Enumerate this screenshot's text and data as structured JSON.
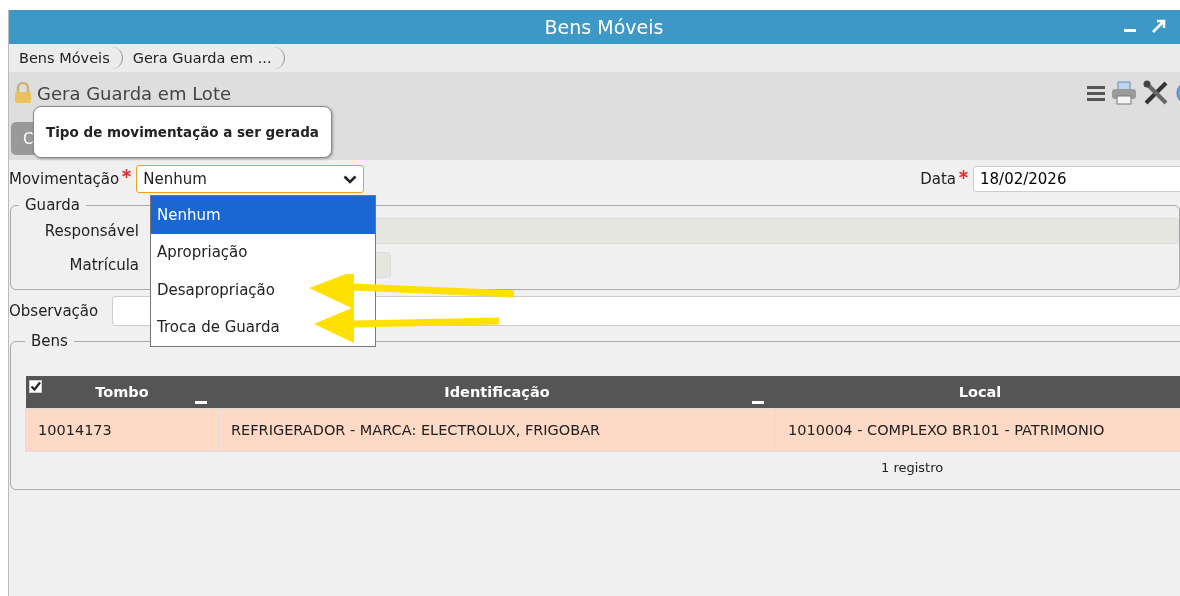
{
  "window": {
    "title": "Bens Móveis"
  },
  "breadcrumbs": [
    {
      "label": "Bens Móveis"
    },
    {
      "label": "Gera Guarda em ..."
    }
  ],
  "page": {
    "title": "Gera Guarda em Lote",
    "button": "C"
  },
  "tooltip": "Tipo de movimentação a ser gerada",
  "form": {
    "movimentacao": {
      "label": "Movimentação",
      "required": true,
      "value": "Nenhum",
      "options": [
        {
          "label": "Nenhum",
          "selected": true
        },
        {
          "label": "Apropriação",
          "selected": false
        },
        {
          "label": "Desapropriação",
          "selected": false
        },
        {
          "label": "Troca de Guarda",
          "selected": false
        }
      ]
    },
    "data": {
      "label": "Data",
      "required": true,
      "value": "18/02/2026"
    },
    "guarda": {
      "legend": "Guarda",
      "fields": [
        {
          "label": "Responsável"
        },
        {
          "label": "Matrícula"
        }
      ]
    },
    "observacao": {
      "label": "Observação"
    }
  },
  "bens": {
    "legend": "Bens",
    "select_all_checked": true,
    "columns": [
      "Tombo",
      "Identificação",
      "Local"
    ],
    "rows": [
      [
        "10014173",
        "REFRIGERADOR - MARCA: ELECTROLUX, FRIGOBAR",
        "1010004 - COMPLEXO BR101 - PATRIMONIO"
      ]
    ],
    "footer": "1 registro"
  }
}
